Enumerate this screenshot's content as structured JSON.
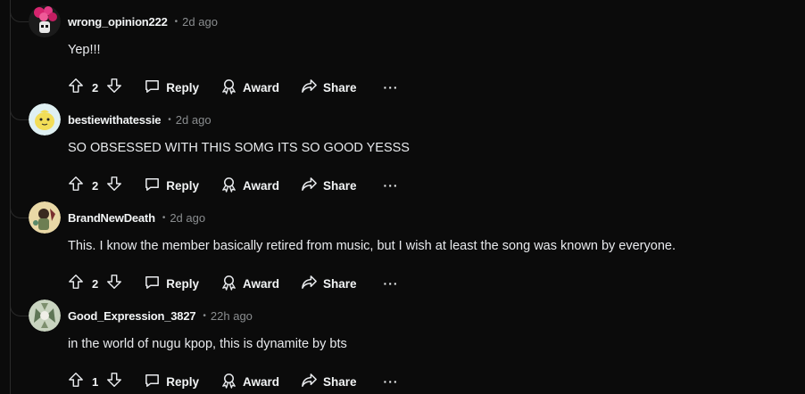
{
  "comments": [
    {
      "username": "wrong_opinion222",
      "separator": "•",
      "time": "2d ago",
      "text": "Yep!!!",
      "score": "2",
      "reply_label": "Reply",
      "award_label": "Award",
      "share_label": "Share",
      "more_label": "···"
    },
    {
      "username": "bestiewithatessie",
      "separator": "•",
      "time": "2d ago",
      "text": "SO OBSESSED WITH THIS SOMG ITS SO GOOD YESSS",
      "score": "2",
      "reply_label": "Reply",
      "award_label": "Award",
      "share_label": "Share",
      "more_label": "···"
    },
    {
      "username": "BrandNewDeath",
      "separator": "•",
      "time": "2d ago",
      "text": "This. I know the member basically retired from music, but I wish at least the song was known by everyone.",
      "score": "2",
      "reply_label": "Reply",
      "award_label": "Award",
      "share_label": "Share",
      "more_label": "···"
    },
    {
      "username": "Good_Expression_3827",
      "separator": "•",
      "time": "22h ago",
      "text": "in the world of nugu kpop, this is dynamite by bts",
      "score": "1",
      "reply_label": "Reply",
      "award_label": "Award",
      "share_label": "Share",
      "more_label": "···"
    }
  ],
  "colors": {
    "background": "#0b0b0b",
    "text": "#d7dadc",
    "muted": "#8a8d8f",
    "thread": "#2a2a2a"
  }
}
